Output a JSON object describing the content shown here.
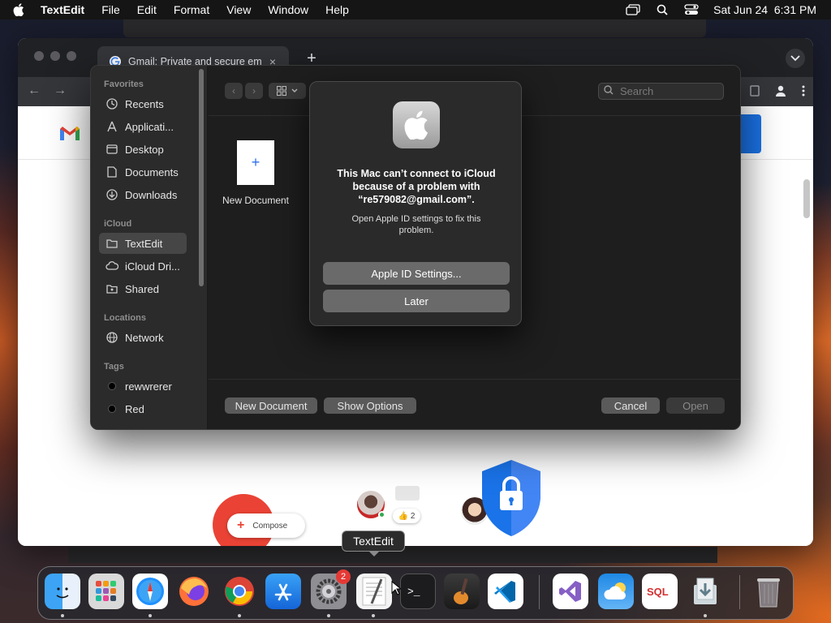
{
  "menubar": {
    "app_name": "TextEdit",
    "menus": [
      "File",
      "Edit",
      "Format",
      "View",
      "Window",
      "Help"
    ],
    "datetime": "Sat Jun 24  6:31 PM"
  },
  "browser": {
    "tab_title": "Gmail: Private and secure em",
    "tab_close": "×",
    "new_tab": "+"
  },
  "gmail": {
    "compose_label": "Compose",
    "reaction_count": "👍 2"
  },
  "open_panel": {
    "sidebar": {
      "favorites_label": "Favorites",
      "favorites": [
        "Recents",
        "Applicati...",
        "Desktop",
        "Documents",
        "Downloads"
      ],
      "icloud_label": "iCloud",
      "icloud": [
        "TextEdit",
        "iCloud Dri...",
        "Shared"
      ],
      "locations_label": "Locations",
      "locations": [
        "Network"
      ],
      "tags_label": "Tags",
      "tags": [
        "rewwrerer",
        "Red"
      ]
    },
    "search_placeholder": "Search",
    "new_document_tile": "New Document",
    "buttons": {
      "new_document": "New Document",
      "show_options": "Show Options",
      "cancel": "Cancel",
      "open": "Open"
    }
  },
  "alert": {
    "title": "This Mac can’t connect to iCloud because of a problem with “re579082@gmail.com”.",
    "message": "Open Apple ID settings to fix this problem.",
    "primary_button": "Apple ID Settings...",
    "secondary_button": "Later"
  },
  "dock": {
    "tooltip": "TextEdit",
    "settings_badge": "2",
    "apps": [
      "finder",
      "launchpad",
      "safari",
      "firefox",
      "chrome",
      "app-store",
      "system-settings",
      "textedit",
      "terminal",
      "garageband",
      "vscode",
      "visual-studio",
      "icloud-weather",
      "sql",
      "downloads-folder",
      "trash"
    ]
  }
}
